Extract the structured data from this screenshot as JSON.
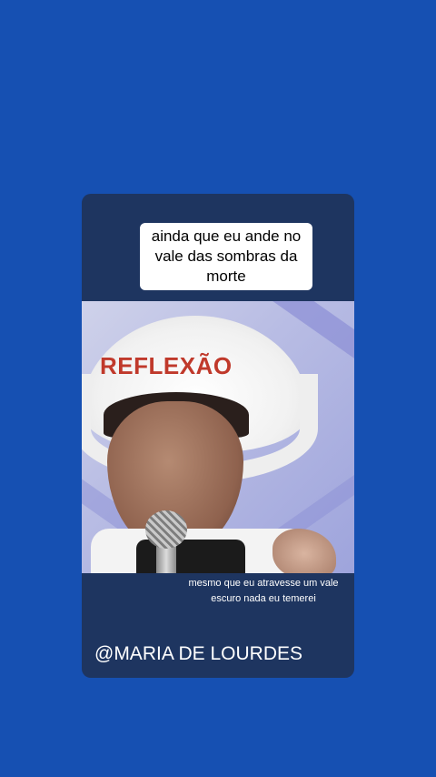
{
  "card": {
    "top_caption": "ainda que eu ande no vale das sombras da morte",
    "overlay_title": "REFLEXÃO",
    "bottom_caption": "mesmo que eu atravesse um vale escuro nada eu temerei",
    "handle": "@MARIA DE LOURDES"
  },
  "colors": {
    "background": "#1650b2",
    "card": "#1e3560",
    "overlay_title": "#c0392b"
  }
}
